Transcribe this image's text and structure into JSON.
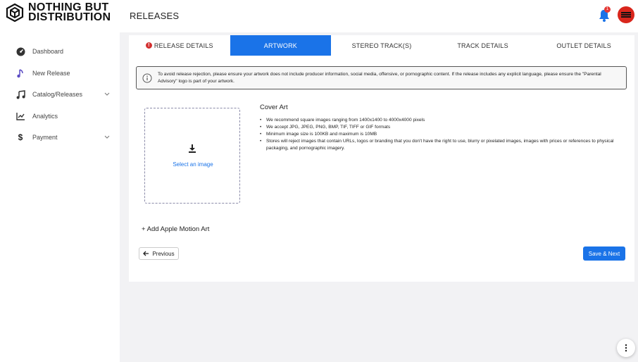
{
  "brand": {
    "line1": "NOTHING BUT",
    "line2": "DISTRIBUTION"
  },
  "header": {
    "title": "RELEASES",
    "notification_count": "1"
  },
  "sidebar": {
    "items": [
      {
        "label": "Dashboard",
        "icon": "dashboard-icon"
      },
      {
        "label": "New Release",
        "icon": "music-note-icon"
      },
      {
        "label": "Catalog/Releases",
        "icon": "music-notes-icon",
        "expandable": true
      },
      {
        "label": "Analytics",
        "icon": "chart-icon"
      },
      {
        "label": "Payment",
        "icon": "dollar-icon",
        "expandable": true
      }
    ]
  },
  "tabs": [
    {
      "label": "RELEASE DETAILS",
      "warning": true
    },
    {
      "label": "ARTWORK",
      "active": true
    },
    {
      "label": "STEREO TRACK(S)"
    },
    {
      "label": "TRACK DETAILS"
    },
    {
      "label": "OUTLET DETAILS"
    }
  ],
  "notice": {
    "text": "To avoid release rejection, please ensure your artwork does not include producer information, social media, offensive, or pornographic content. If the release includes any explicit language, please ensure the \"Parental Advisory\" logo is part of your artwork."
  },
  "upload": {
    "label": "Select an image"
  },
  "cover_art": {
    "title": "Cover Art",
    "requirements": [
      "We recommend square images ranging from 1400x1400 to 4000x4000 pixels",
      "We accept JPG, JPEG, PNG, BMP, TIF, TIFF or GIF formats",
      "Minimum image size is 100KB and maximum is 10MB",
      "Stores will reject images that contain URLs, logos or branding that you don't have the right to use, blurry or pixelated images, images with prices or references to physical packaging, and pornographic imagery."
    ]
  },
  "motion_art": {
    "label": "+ Add Apple Motion Art"
  },
  "buttons": {
    "previous": "Previous",
    "next": "Save & Next"
  },
  "colors": {
    "accent": "#1a73e8",
    "warning": "#d32f2f",
    "avatar": "#d9261c"
  }
}
